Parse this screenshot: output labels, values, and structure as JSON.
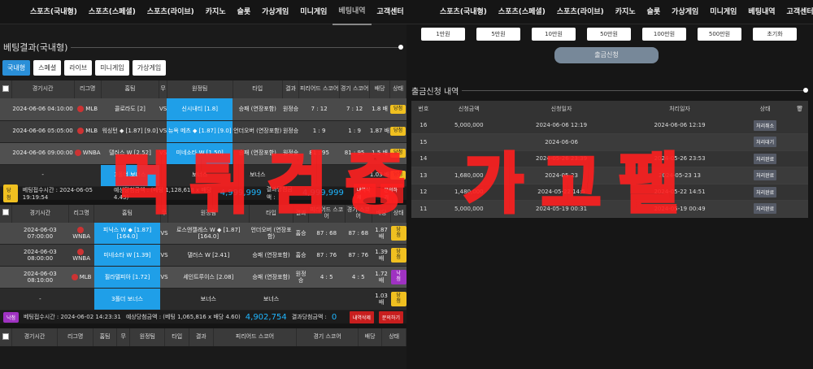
{
  "nav_left": [
    "스포츠(국내형)",
    "스포츠(스페셜)",
    "스포츠(라이브)",
    "카지노",
    "슬롯",
    "가상게임",
    "미니게임",
    "베팅내역",
    "고객센터",
    "공지사항",
    "이벤트"
  ],
  "nav_right": [
    "스포츠(국내형)",
    "스포츠(스페셜)",
    "스포츠(라이브)",
    "카지노",
    "슬롯",
    "가상게임",
    "미니게임",
    "베팅내역",
    "고객센터",
    "공지사항",
    "이벤트"
  ],
  "bet_section_title": "베팅결과(국내형)",
  "bet_tabs": [
    "국내형",
    "스페셜",
    "라이브",
    "미니게임",
    "가상게임"
  ],
  "bet_headers": [
    "경기시간",
    "리그명",
    "홈팀",
    "무",
    "원정팀",
    "타입",
    "결과",
    "피리어드 스코어",
    "경기 스코어",
    "배당",
    "상태"
  ],
  "bet_groups": [
    {
      "rows": [
        {
          "time": "2024-06-06 04:10:00",
          "league": "MLB",
          "home": "콜로라도 [2]",
          "draw": "VS",
          "away": "신시내티 [1.8]",
          "type": "승패 (연장포함)",
          "result": "원정승",
          "period": "7 : 12",
          "score": "7 : 12",
          "odds": "1.8 배",
          "status": "당첨"
        },
        {
          "time": "2024-06-06 05:05:00",
          "league": "MLB",
          "home": "워싱턴 ◆ [1.87] [9.0]",
          "draw": "VS",
          "away": "뉴욕 메츠 ◆ [1.87] [9.0]",
          "type": "언더오버 (연장포함)",
          "result": "원정승",
          "period": "1 : 9",
          "score": "1 : 9",
          "odds": "1.87 배",
          "status": "당첨"
        },
        {
          "time": "2024-06-06 09:00:00",
          "league": "WNBA",
          "home": "댈러스 W [2.52]",
          "draw": "VS",
          "away": "미네소타 W [1.50]",
          "type": "승패 (연장포함)",
          "result": "원정승",
          "period": "81 : 95",
          "score": "81 : 95",
          "odds": "1.5 배",
          "status": "당첨"
        }
      ],
      "bonus": {
        "time": "-",
        "home": "3폴더 보너스",
        "away": "보너스",
        "type": "보너스",
        "odds": "1.03 배",
        "status": "당첨"
      },
      "footer": {
        "status": "당첨",
        "bet_time": "베팅접수시간 : 2024-06-05 19:19:54",
        "expected": "예상당첨금액 : (베팅 1,128,618 x 배당 4.43)",
        "amount": "4,999,999",
        "result_label": "결과당첨금액 :",
        "result_amount": "4,999,999",
        "delete": "내역삭제",
        "inquiry": "문의하기"
      }
    },
    {
      "rows": [
        {
          "time": "2024-06-03 07:00:00",
          "league": "WNBA",
          "home": "피닉스 W ◆ [1.87] [164.0]",
          "draw": "VS",
          "away": "로스앤젤레스 W ◆ [1.87] [164.0]",
          "type": "언더오버 (연장포함)",
          "result": "홈승",
          "period": "87 : 68",
          "score": "87 : 68",
          "odds": "1.87 배",
          "status": "당첨"
        },
        {
          "time": "2024-06-03 08:00:00",
          "league": "WNBA",
          "home": "미네소타 W [1.39]",
          "draw": "VS",
          "away": "댈러스 W [2.41]",
          "type": "승패 (연장포함)",
          "result": "홈승",
          "period": "87 : 76",
          "score": "87 : 76",
          "odds": "1.39 배",
          "status": "당첨"
        },
        {
          "time": "2024-06-03 08:10:00",
          "league": "MLB",
          "home": "필라델피아 [1.72]",
          "draw": "VS",
          "away": "세인트루이스 [2.08]",
          "type": "승패 (연장포함)",
          "result": "원정승",
          "period": "4 : 5",
          "score": "4 : 5",
          "odds": "1.72 배",
          "status": "낙첨"
        }
      ],
      "bonus": {
        "time": "-",
        "home": "3폴더 보너스",
        "away": "보너스",
        "type": "보너스",
        "odds": "1.03 배",
        "status": "당첨"
      },
      "footer": {
        "status": "낙첨",
        "bet_time": "베팅접수시간 : 2024-06-02 14:23:31",
        "expected": "예상당첨금액 : (베팅 1,065,816 x 배당 4.60)",
        "amount": "4,902,754",
        "result_label": "결과당첨금액 :",
        "result_amount": "0",
        "delete": "내역삭제",
        "inquiry": "문의하기"
      }
    }
  ],
  "amount_buttons": [
    "1만원",
    "5만원",
    "10만원",
    "50만원",
    "100만원",
    "500만원",
    "초기화"
  ],
  "withdraw_button": "출금신청",
  "withdraw_title": "출금신청 내역",
  "withdraw_headers": [
    "번호",
    "신청금액",
    "신청일자",
    "처리일자",
    "상태",
    "🗑"
  ],
  "withdraw_rows": [
    {
      "no": "16",
      "amount": "5,000,000",
      "req": "2024-06-06 12:19",
      "done": "2024-06-06 12:19",
      "status": "처리취소"
    },
    {
      "no": "15",
      "amount": "",
      "req": "2024-06-06",
      "done": "",
      "status": "처리대기"
    },
    {
      "no": "14",
      "amount": "",
      "req": "2024-05-26 23:39",
      "done": "2024-05-26 23:53",
      "status": "처리완료"
    },
    {
      "no": "13",
      "amount": "1,680,000",
      "req": "2024-05-23",
      "done": "2024-05-23 13",
      "status": "처리완료"
    },
    {
      "no": "12",
      "amount": "1,480,000",
      "req": "2024-05-22 14:5",
      "done": "2024-05-22 14:51",
      "status": "처리완료"
    },
    {
      "no": "11",
      "amount": "5,000,000",
      "req": "2024-05-19 00:31",
      "done": "2024-05-19 00:49",
      "status": "처리완료"
    }
  ],
  "watermark": "먹튀검증 가고팰"
}
